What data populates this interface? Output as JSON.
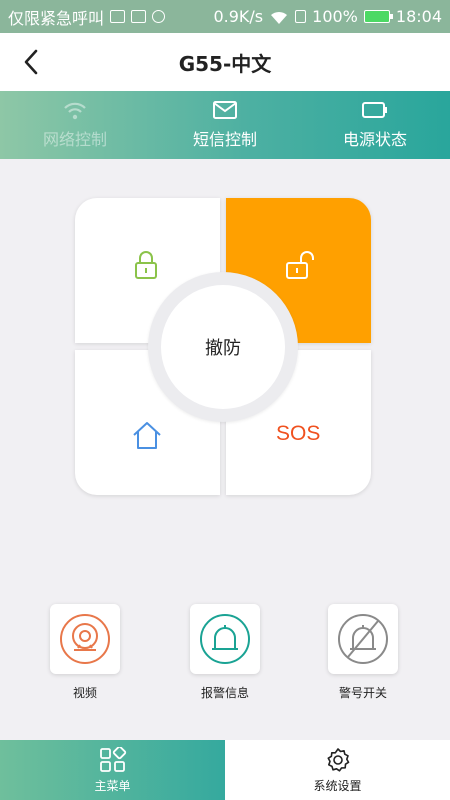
{
  "status_bar": {
    "carrier": "仅限紧急呼叫",
    "speed": "0.9K/s",
    "battery": "100%",
    "time": "18:04"
  },
  "header": {
    "title": "G55-中文"
  },
  "tabs": [
    {
      "label": "网络控制",
      "icon": "wifi-icon",
      "enabled": false
    },
    {
      "label": "短信控制",
      "icon": "mail-icon",
      "enabled": true
    },
    {
      "label": "电源状态",
      "icon": "battery-icon",
      "enabled": true
    }
  ],
  "pad": {
    "arm_icon": "lock-icon",
    "disarm_icon": "unlock-icon",
    "home_icon": "home-icon",
    "sos_label": "SOS",
    "center_label": "撤防",
    "active_color": "#ffa000"
  },
  "functions": [
    {
      "label": "视频",
      "icon": "camera-icon",
      "color": "#e8774a"
    },
    {
      "label": "报警信息",
      "icon": "alarm-bell-icon",
      "color": "#1aa394"
    },
    {
      "label": "警号开关",
      "icon": "siren-off-icon",
      "color": "#8a8a8a"
    }
  ],
  "bottom_nav": [
    {
      "label": "主菜单",
      "icon": "menu-grid-icon",
      "active": true
    },
    {
      "label": "系统设置",
      "icon": "gear-icon",
      "active": false
    }
  ]
}
